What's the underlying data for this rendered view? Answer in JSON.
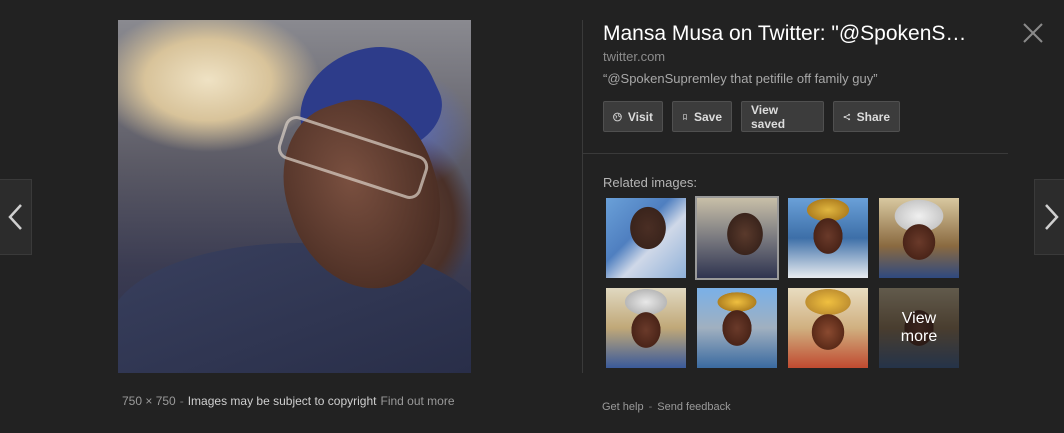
{
  "panel": {
    "title": "Mansa Musa on Twitter: \"@SpokenS…",
    "domain": "twitter.com",
    "caption": "“@SpokenSupremley that petifile off family guy”"
  },
  "actions": {
    "visit": "Visit",
    "save": "Save",
    "view_saved": "View saved",
    "share": "Share"
  },
  "related": {
    "label": "Related images:",
    "view_more_line1": "View",
    "view_more_line2": "more"
  },
  "image_meta": {
    "dimensions": "750 × 750",
    "separator": "-",
    "copyright": "Images may be subject to copyright",
    "find_out_more": "Find out more"
  },
  "footer": {
    "help": "Get help",
    "separator": "-",
    "feedback": "Send feedback"
  },
  "icons": {
    "prev": "chevron-left-icon",
    "next": "chevron-right-icon",
    "close": "close-icon",
    "visit": "globe-icon",
    "save": "bookmark-icon",
    "share": "share-icon"
  }
}
